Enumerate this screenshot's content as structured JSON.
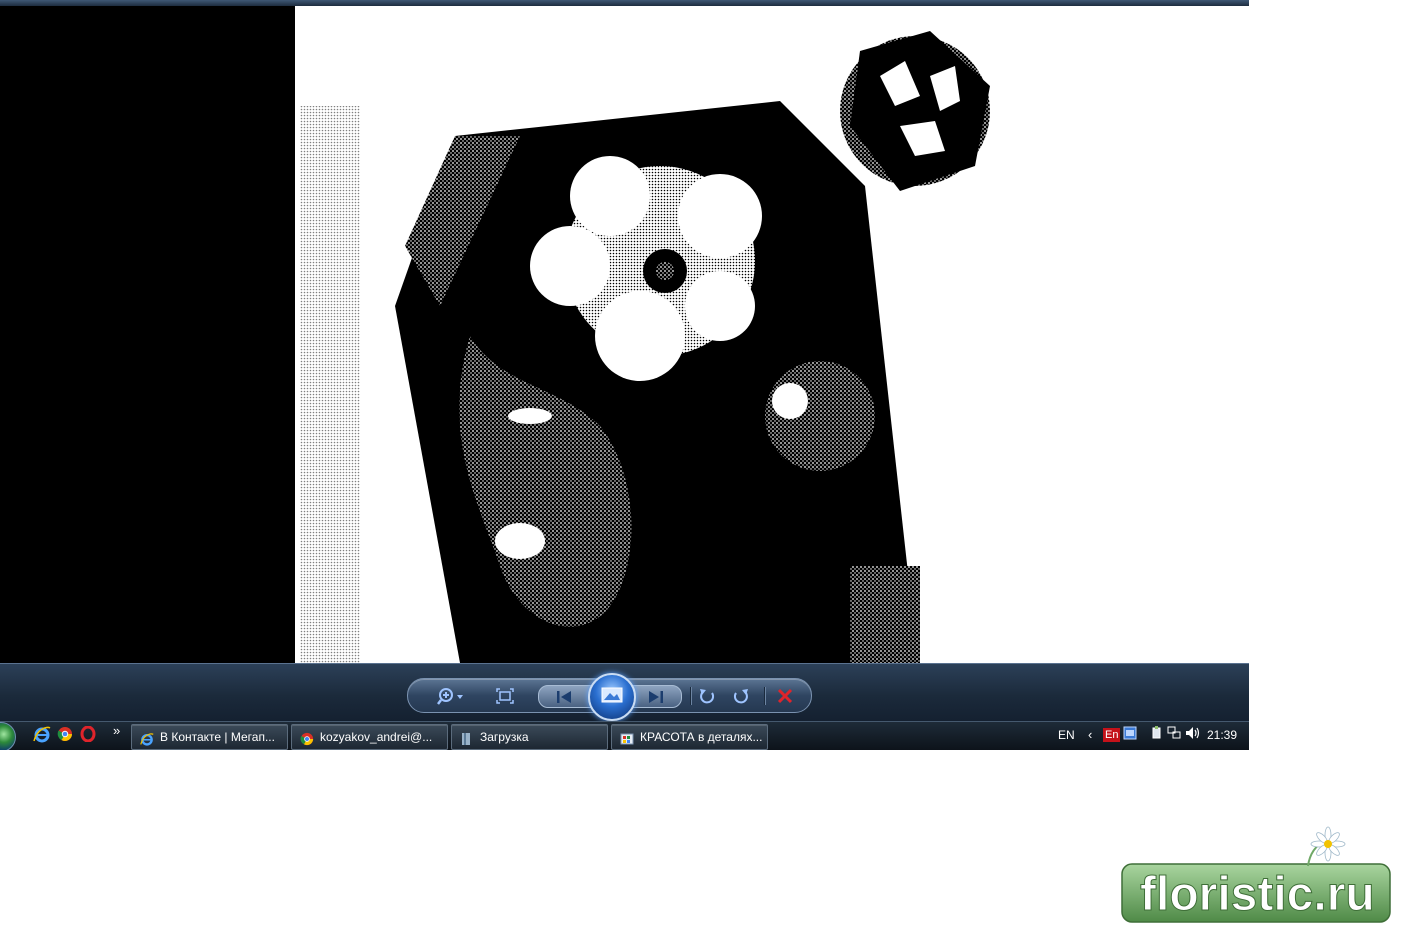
{
  "viewer": {
    "photo_description_icon": "monochrome-portrait-image",
    "toolbar": {
      "buttons": [
        {
          "icon": "zoom-icon"
        },
        {
          "icon": "actual-size-icon"
        },
        {
          "icon": "previous-icon"
        },
        {
          "icon": "slideshow-icon"
        },
        {
          "icon": "next-icon"
        },
        {
          "icon": "rotate-counterclockwise-icon"
        },
        {
          "icon": "rotate-clockwise-icon"
        },
        {
          "icon": "delete-icon"
        }
      ]
    }
  },
  "taskbar": {
    "quick_launch": [
      {
        "icon": "internet-explorer-icon"
      },
      {
        "icon": "chrome-icon"
      },
      {
        "icon": "opera-icon"
      }
    ],
    "more_symbol": "»",
    "tasks": [
      {
        "label": "В Контакте | Мегап...",
        "icon": "internet-explorer-icon"
      },
      {
        "label": "kozyakov_andrei@...",
        "icon": "chrome-icon"
      },
      {
        "label": "Загрузка",
        "icon": "folder-icon"
      },
      {
        "label": "КРАСОТА в деталях...",
        "icon": "photo-viewer-icon"
      }
    ],
    "tray": {
      "language": "EN",
      "chevron": "‹",
      "input_indicator": "En",
      "clock": "21:39"
    }
  },
  "watermark": {
    "text": "floristic.ru"
  },
  "colors": {
    "taskbar_bg": "#0c1219",
    "toolbar_bg": "#1b2a3b",
    "accent_blue": "#2a6fd0",
    "delete_red": "#e0242b",
    "watermark_green": "#6fa866"
  }
}
